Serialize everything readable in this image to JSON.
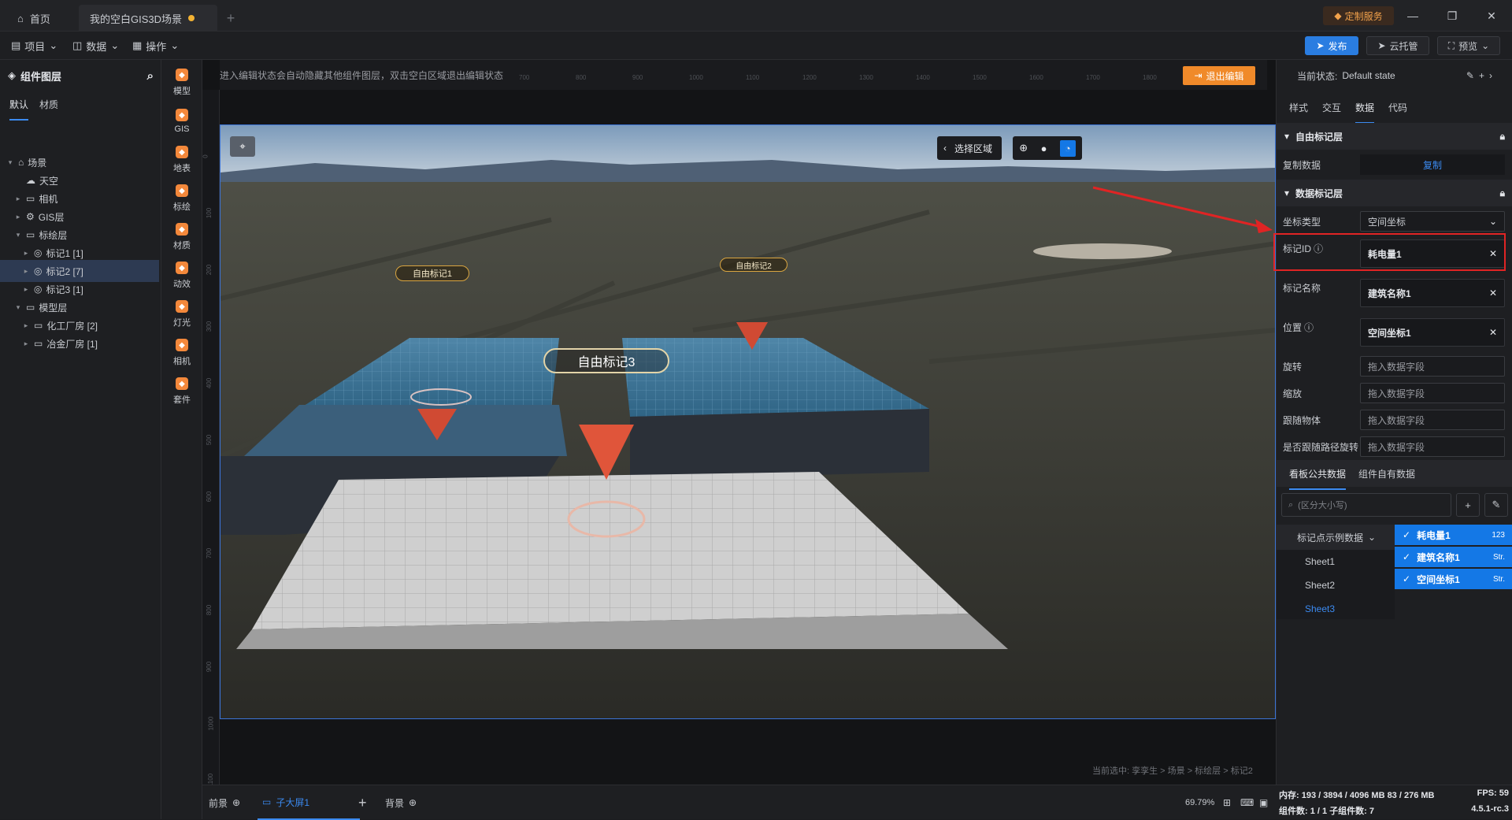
{
  "titlebar": {
    "home_tab": "首页",
    "scene_tab": "我的空白GIS3D场景",
    "custom_service": "定制服务"
  },
  "menubar": {
    "project": "项目",
    "data": "数据",
    "operate": "操作",
    "publish": "发布",
    "cloud": "云托管",
    "preview": "预览"
  },
  "layers": {
    "title": "组件图层",
    "tabs": [
      "默认",
      "材质"
    ],
    "tree": [
      {
        "label": "场景",
        "depth": 0,
        "icon": "scene-icon"
      },
      {
        "label": "天空",
        "depth": 1,
        "icon": "sky-icon"
      },
      {
        "label": "相机",
        "depth": 1,
        "icon": "folder-icon"
      },
      {
        "label": "GIS层",
        "depth": 1,
        "icon": "gis-icon"
      },
      {
        "label": "标绘层",
        "depth": 1,
        "icon": "folder-icon"
      },
      {
        "label": "标记1 [1]",
        "depth": 2,
        "icon": "marker-icon"
      },
      {
        "label": "标记2 [7]",
        "depth": 2,
        "icon": "marker-icon"
      },
      {
        "label": "标记3 [1]",
        "depth": 2,
        "icon": "marker-icon"
      },
      {
        "label": "模型层",
        "depth": 1,
        "icon": "folder-icon"
      },
      {
        "label": "化工厂房 [2]",
        "depth": 2,
        "icon": "folder-icon"
      },
      {
        "label": "冶金厂房 [1]",
        "depth": 2,
        "icon": "folder-icon"
      }
    ]
  },
  "iconbar": [
    "模型",
    "GIS",
    "地表",
    "标绘",
    "材质",
    "动效",
    "灯光",
    "相机",
    "套件"
  ],
  "canvas": {
    "hint": "进入编辑状态会自动隐藏其他组件图层，双击空白区域退出编辑状态",
    "exit_edit": "退出编辑",
    "select_area": "选择区域",
    "marker1": "自由标记1",
    "marker2": "自由标记2",
    "marker3": "自由标记3",
    "breadcrumb": "当前选中: 孪孪生 > 场景 > 标绘层 > 标记2",
    "ruler_h": [
      "600",
      "700",
      "800",
      "900",
      "1000",
      "1100",
      "1200",
      "1300",
      "1400",
      "1500",
      "1600",
      "1700",
      "1800"
    ],
    "ruler_v": [
      "0",
      "100",
      "200",
      "300",
      "400",
      "500",
      "600",
      "700",
      "800",
      "900",
      "1000",
      "1100"
    ]
  },
  "bottombar": {
    "foreground": "前景",
    "sub_screen": "子大屏1",
    "background": "背景",
    "zoom": "69.79%"
  },
  "rightpanel": {
    "state_label": "当前状态:",
    "state_value": "Default state",
    "tabs": [
      "样式",
      "交互",
      "数据",
      "代码"
    ],
    "section_free": "自由标记层",
    "copy_label": "复制数据",
    "copy_btn": "复制",
    "section_data": "数据标记层",
    "coord_type_label": "坐标类型",
    "coord_type_value": "空间坐标",
    "mark_id_label": "标记ID",
    "mark_id_value": "耗电量1",
    "mark_name_label": "标记名称",
    "mark_name_value": "建筑名称1",
    "position_label": "位置",
    "position_value": "空间坐标1",
    "rotate_label": "旋转",
    "scale_label": "缩放",
    "follow_label": "跟随物体",
    "follow_path_label": "是否跟随路径旋转",
    "drag_placeholder": "拖入数据字段",
    "source_tabs": [
      "看板公共数据",
      "组件自有数据"
    ],
    "search_placeholder": "(区分大小写)",
    "dataset": "标记点示例数据",
    "sheets": [
      "Sheet1",
      "Sheet2",
      "Sheet3"
    ],
    "fields": [
      {
        "name": "耗电量1",
        "type": "123"
      },
      {
        "name": "建筑名称1",
        "type": "Str."
      },
      {
        "name": "空间坐标1",
        "type": "Str."
      }
    ]
  },
  "status": {
    "memory": "内存: 193 / 3894 / 4096 MB  83 / 276 MB",
    "fps": "FPS: 59",
    "components": "组件数: 1 / 1   子组件数: 7",
    "version": "4.5.1-rc.3"
  }
}
